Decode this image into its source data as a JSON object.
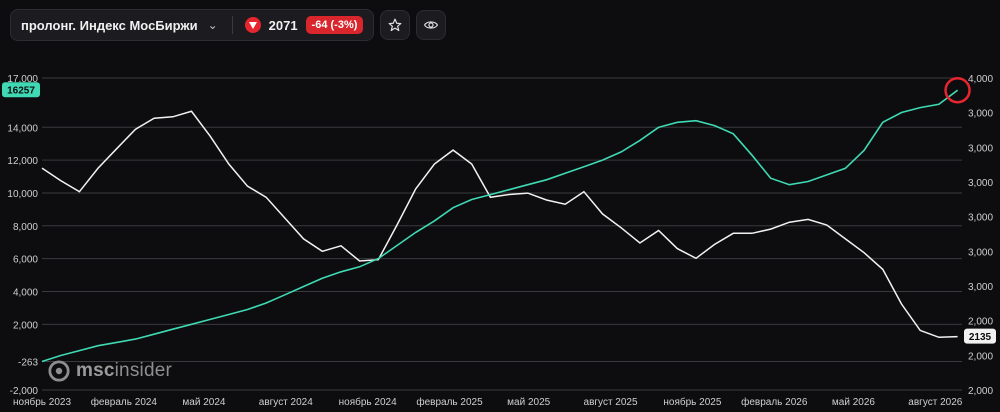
{
  "toolbar": {
    "ticker_name": "пролонг. Индекс МосБиржи",
    "price": "2071",
    "change": "-64 (-3%)",
    "dropdown_icon": "chevron-down-icon",
    "direction_icon": "triangle-down-icon",
    "star_icon": "star-icon",
    "eye_icon": "eye-icon"
  },
  "brand": {
    "prefix": "msc",
    "suffix": "insider",
    "icon": "brand-logo-icon"
  },
  "colors": {
    "teal": "#3fd9b4",
    "white_line": "#f2f2f2",
    "grid": "#3a3a3e",
    "accent_red": "#e5262f",
    "background": "#0d0d0f"
  },
  "chart_data": {
    "type": "line",
    "x": [
      "2023-11-01",
      "2023-11-22",
      "2023-12-13",
      "2024-01-03",
      "2024-01-24",
      "2024-02-14",
      "2024-03-06",
      "2024-03-27",
      "2024-04-17",
      "2024-05-08",
      "2024-05-29",
      "2024-06-19",
      "2024-07-10",
      "2024-07-31",
      "2024-08-21",
      "2024-09-11",
      "2024-10-02",
      "2024-10-23",
      "2024-11-13",
      "2024-12-04",
      "2024-12-25",
      "2025-01-15",
      "2025-02-05",
      "2025-02-26",
      "2025-03-19",
      "2025-04-09",
      "2025-04-30",
      "2025-05-21",
      "2025-06-11",
      "2025-07-02",
      "2025-07-23",
      "2025-08-13",
      "2025-09-03",
      "2025-09-24",
      "2025-10-15",
      "2025-11-05",
      "2025-11-26",
      "2025-12-17",
      "2026-01-07",
      "2026-01-28",
      "2026-02-18",
      "2026-03-11",
      "2026-04-01",
      "2026-04-22",
      "2026-05-13",
      "2026-06-03",
      "2026-06-24",
      "2026-07-15",
      "2026-08-05",
      "2026-08-26"
    ],
    "x_tick_labels": [
      "ноябрь 2023",
      "февраль 2024",
      "май 2024",
      "август 2024",
      "ноябрь 2024",
      "февраль 2025",
      "май 2025",
      "август 2025",
      "ноябрь 2025",
      "февраль 2026",
      "май 2026",
      "август 2026"
    ],
    "x_tick_dates": [
      "2023-11-01",
      "2024-02-01",
      "2024-05-01",
      "2024-08-01",
      "2024-11-01",
      "2025-02-01",
      "2025-05-01",
      "2025-08-01",
      "2025-11-01",
      "2026-02-01",
      "2026-05-01",
      "2026-08-01"
    ],
    "x_range": [
      "2023-11-01",
      "2026-08-31"
    ],
    "left_axis": {
      "ticks": [
        "17,000",
        "14,000",
        "12,000",
        "10,000",
        "8,000",
        "6,000",
        "4,000",
        "2,000",
        "-263",
        "-2,000"
      ],
      "tick_values": [
        17000,
        14000,
        12000,
        10000,
        8000,
        6000,
        4000,
        2000,
        -263,
        -2000
      ],
      "ylim": [
        -2000,
        17000
      ],
      "current_value_label": "16257",
      "current_value": 16257
    },
    "right_axis": {
      "ticks": [
        "4,000",
        "3,000",
        "3,000",
        "3,000",
        "3,000",
        "3,000",
        "3,000",
        "2,000",
        "2,000",
        "2,000"
      ],
      "tick_values": [
        4000,
        3750,
        3500,
        3250,
        3000,
        2750,
        2500,
        2250,
        2000,
        1750
      ],
      "ylim": [
        1750,
        4000
      ],
      "current_value_label": "2135",
      "current_value": 2135
    },
    "series": [
      {
        "axis": "left",
        "color": "#3fd9b4",
        "values": [
          -263,
          100,
          400,
          700,
          900,
          1100,
          1400,
          1700,
          2000,
          2300,
          2600,
          2900,
          3300,
          3800,
          4300,
          4800,
          5200,
          5500,
          6000,
          6800,
          7600,
          8300,
          9100,
          9600,
          9900,
          10200,
          10500,
          10800,
          11200,
          11600,
          12000,
          12500,
          13200,
          14000,
          14300,
          14400,
          14100,
          13600,
          12300,
          10900,
          10500,
          10700,
          11100,
          11500,
          12600,
          14300,
          14900,
          15200,
          15400,
          16257
        ]
      },
      {
        "axis": "right",
        "color": "#f2f2f2",
        "values": [
          3350,
          3260,
          3180,
          3350,
          3490,
          3630,
          3710,
          3720,
          3760,
          3580,
          3380,
          3220,
          3140,
          2990,
          2840,
          2750,
          2790,
          2680,
          2690,
          2940,
          3200,
          3380,
          3480,
          3380,
          3140,
          3160,
          3170,
          3120,
          3090,
          3180,
          3020,
          2920,
          2810,
          2900,
          2770,
          2700,
          2800,
          2880,
          2880,
          2910,
          2960,
          2980,
          2940,
          2840,
          2740,
          2620,
          2370,
          2180,
          2130,
          2135
        ]
      }
    ]
  }
}
